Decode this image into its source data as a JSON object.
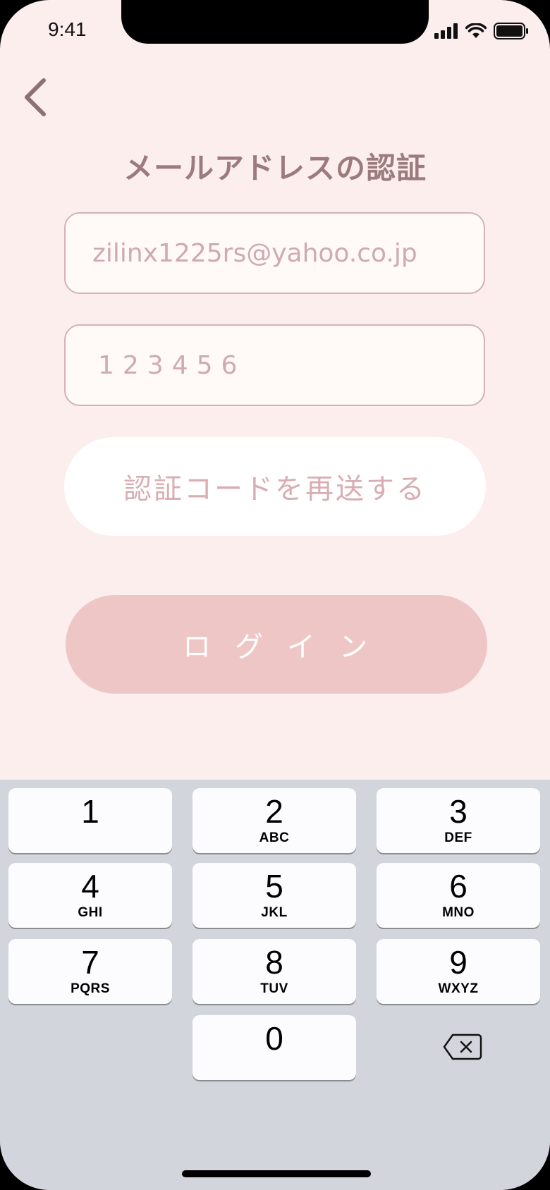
{
  "status_bar": {
    "time": "9:41"
  },
  "header": {
    "title": "メールアドレスの認証"
  },
  "form": {
    "email_value": "zilinx1225rs@yahoo.co.jp",
    "code_value": "123456",
    "resend_label": "認証コードを再送する",
    "login_label": "ログイン"
  },
  "keypad": {
    "keys": [
      {
        "num": "1",
        "letters": ""
      },
      {
        "num": "2",
        "letters": "ABC"
      },
      {
        "num": "3",
        "letters": "DEF"
      },
      {
        "num": "4",
        "letters": "GHI"
      },
      {
        "num": "5",
        "letters": "JKL"
      },
      {
        "num": "6",
        "letters": "MNO"
      },
      {
        "num": "7",
        "letters": "PQRS"
      },
      {
        "num": "8",
        "letters": "TUV"
      },
      {
        "num": "9",
        "letters": "WXYZ"
      },
      {
        "num": "0",
        "letters": ""
      }
    ]
  },
  "colors": {
    "background": "#fdeeee",
    "title": "#9b7b7e",
    "field_border": "#d2b2b6",
    "placeholder_text": "#cfaaae",
    "login_button": "#efc6c6"
  }
}
